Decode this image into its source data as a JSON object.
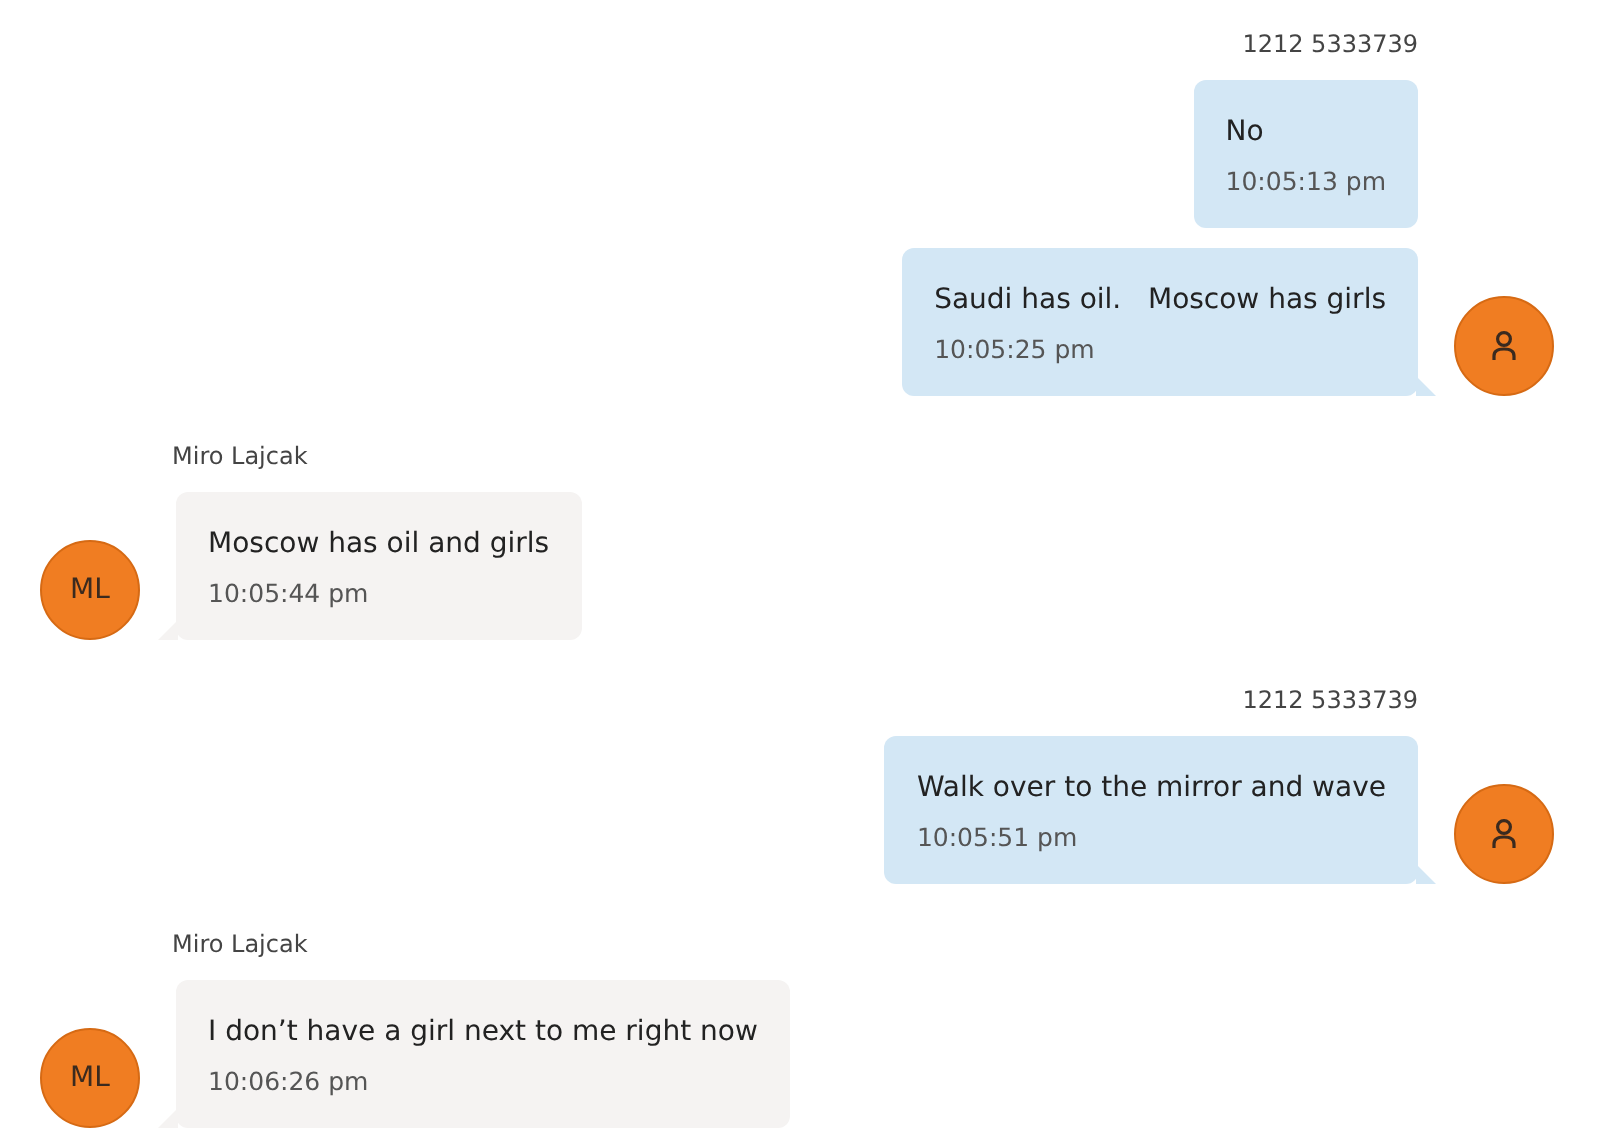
{
  "conversation": [
    {
      "kind": "outgoing",
      "sender": "1212 5333739",
      "avatar": {
        "kind": "person"
      },
      "messages": [
        {
          "text": "No",
          "time": "10:05:13 pm"
        },
        {
          "text": "Saudi has oil.   Moscow has girls",
          "time": "10:05:25 pm"
        }
      ]
    },
    {
      "kind": "incoming",
      "sender": "Miro Lajcak",
      "avatar": {
        "kind": "initials",
        "initials": "ML"
      },
      "messages": [
        {
          "text": "Moscow has oil and girls",
          "time": "10:05:44 pm"
        }
      ]
    },
    {
      "kind": "outgoing",
      "sender": "1212 5333739",
      "avatar": {
        "kind": "person"
      },
      "messages": [
        {
          "text": "Walk over to the mirror and wave",
          "time": "10:05:51 pm"
        }
      ]
    },
    {
      "kind": "incoming",
      "sender": "Miro Lajcak",
      "avatar": {
        "kind": "initials",
        "initials": "ML"
      },
      "messages": [
        {
          "text": "I don’t have a girl next to me right now",
          "time": "10:06:26 pm"
        }
      ]
    }
  ]
}
